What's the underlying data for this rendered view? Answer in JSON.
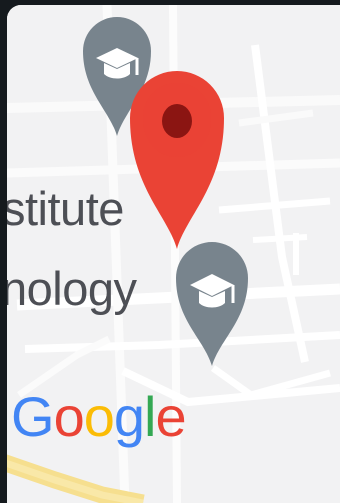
{
  "map": {
    "place_name_line_1": "stitute",
    "place_name_line_2": "nology",
    "attribution_letters": [
      "G",
      "o",
      "o",
      "g",
      "l",
      "e"
    ],
    "attribution_colors": [
      "#4285f4",
      "#ea4335",
      "#fbbc05",
      "#4285f4",
      "#34a853",
      "#ea4335"
    ],
    "background_color": "#f2f2f3",
    "road_color": "#ffffff",
    "highway_color": "#f6df8f"
  },
  "markers": {
    "selected_pin": {
      "icon": "red-location-pin-icon",
      "color": "#ea4335",
      "center_color": "#8b1512"
    },
    "school_pins": [
      {
        "icon": "graduation-cap-icon",
        "color": "#78848d"
      },
      {
        "icon": "graduation-cap-icon",
        "color": "#78848d"
      }
    ]
  }
}
